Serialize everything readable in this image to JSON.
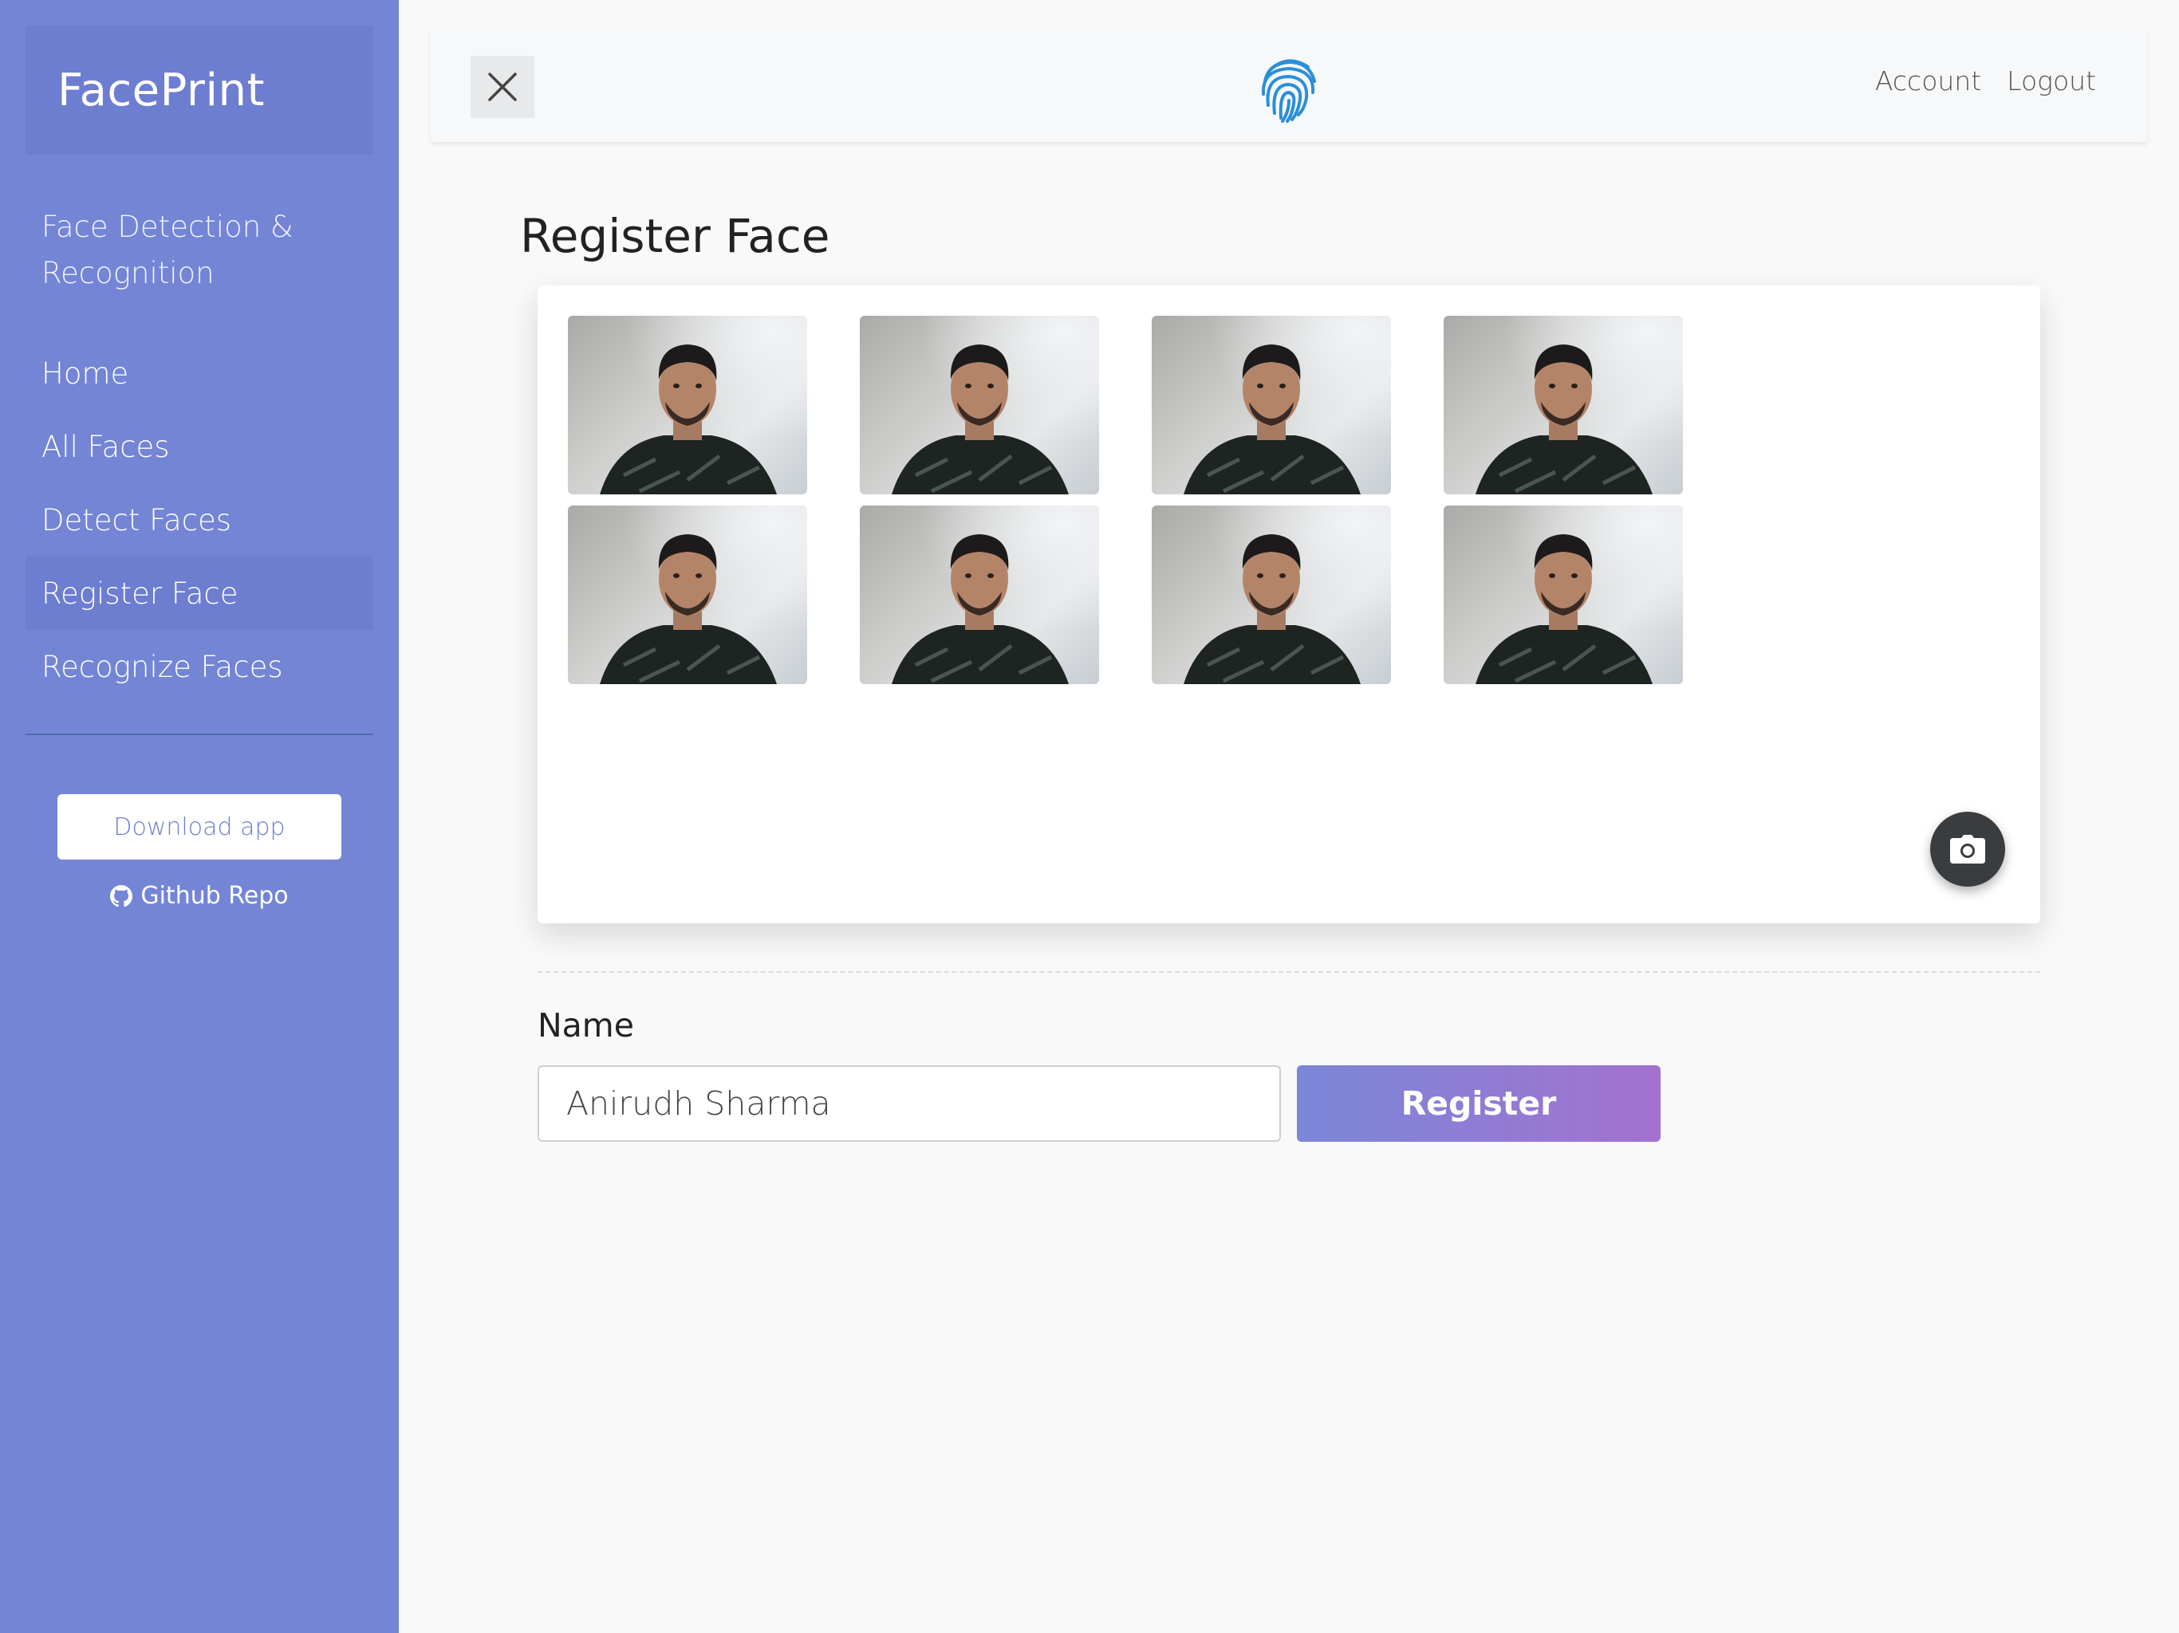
{
  "sidebar": {
    "brand": "FacePrint",
    "tagline": "Face Detection & Recognition",
    "items": [
      {
        "label": "Home"
      },
      {
        "label": "All Faces"
      },
      {
        "label": "Detect Faces"
      },
      {
        "label": "Register Face"
      },
      {
        "label": "Recognize Faces"
      }
    ],
    "active_item": "Register Face",
    "download_label": "Download app",
    "github_label": "Github Repo"
  },
  "topbar": {
    "close_icon": "close-icon",
    "logo_icon": "fingerprint-icon",
    "links": [
      "Account",
      "Logout"
    ]
  },
  "main": {
    "title": "Register Face",
    "captured_count": 8,
    "camera_icon": "camera-icon",
    "form": {
      "name_label": "Name",
      "name_value": "Anirudh Sharma",
      "register_label": "Register"
    }
  },
  "colors": {
    "sidebar": "#7485d6",
    "sidebar_active": "#6d7dd0",
    "accent_start": "#7a87d8",
    "accent_end": "#a471d0",
    "logo_blue": "#2b8fd9"
  }
}
